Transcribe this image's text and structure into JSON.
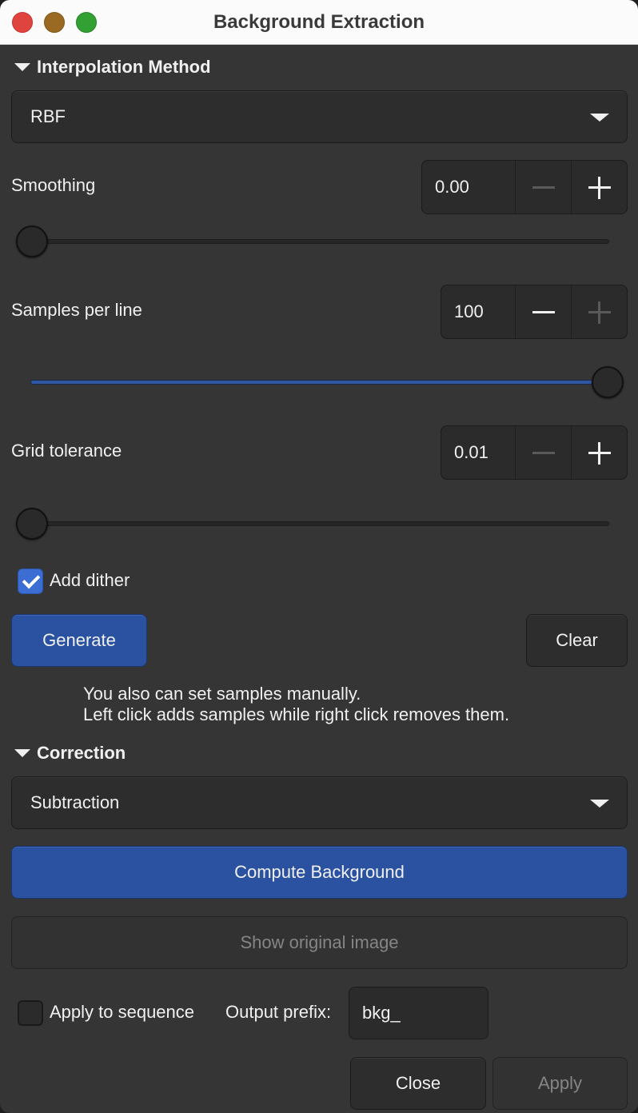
{
  "window": {
    "title": "Background Extraction"
  },
  "interpolation": {
    "section_label": "Interpolation Method",
    "method": "RBF",
    "smoothing": {
      "label": "Smoothing",
      "value": "0.00",
      "slider_fraction": 0.0
    },
    "samples": {
      "label": "Samples per line",
      "value": "100",
      "slider_fraction": 1.0
    },
    "grid": {
      "label": "Grid tolerance",
      "value": "0.01",
      "slider_fraction": 0.0
    },
    "dither": {
      "label": "Add dither",
      "checked": true
    },
    "generate_label": "Generate",
    "clear_label": "Clear",
    "hint_line1": "You also can set samples manually.",
    "hint_line2": "Left click adds samples while right click removes them."
  },
  "correction": {
    "section_label": "Correction",
    "mode": "Subtraction",
    "compute_label": "Compute Background",
    "show_original_label": "Show original image",
    "apply_sequence_label": "Apply to sequence",
    "apply_sequence_checked": false,
    "output_prefix_label": "Output prefix:",
    "output_prefix_value": "bkg_"
  },
  "footer": {
    "close_label": "Close",
    "apply_label": "Apply"
  },
  "colors": {
    "accent": "#2b52a0",
    "background": "#353535"
  }
}
